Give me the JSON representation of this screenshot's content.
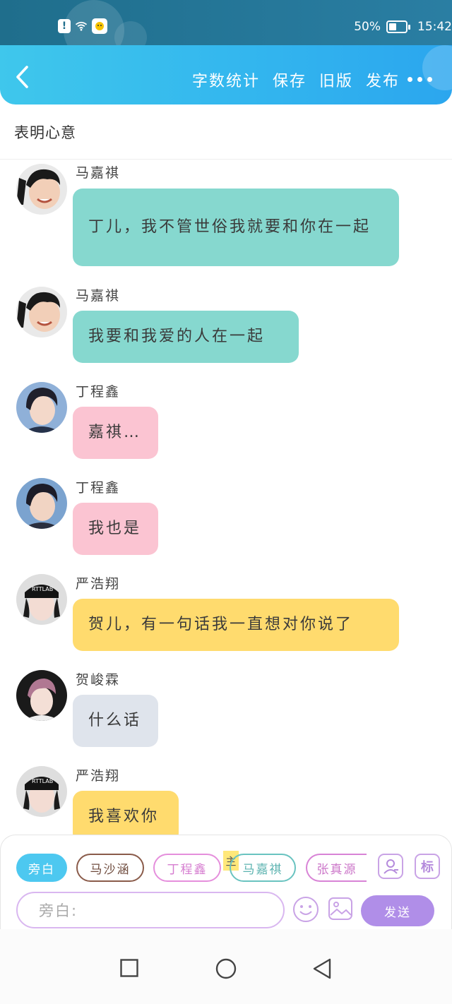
{
  "status_bar": {
    "battery_text": "50%",
    "time": "15:42",
    "battery_level": 0.5
  },
  "header": {
    "actions": [
      "字数统计",
      "保存",
      "旧版",
      "发布"
    ]
  },
  "title": "表明心意",
  "messages": [
    {
      "sender": "马嘉祺",
      "text": "丁儿，我不管世俗我就要和你在一起",
      "color": "#86d8cf"
    },
    {
      "sender": "马嘉祺",
      "text": "我要和我爱的人在一起",
      "color": "#86d8cf"
    },
    {
      "sender": "丁程鑫",
      "text": "嘉祺…",
      "color": "#fbc4d2"
    },
    {
      "sender": "丁程鑫",
      "text": "我也是",
      "color": "#fbc4d2"
    },
    {
      "sender": "严浩翔",
      "text": "贺儿，有一句话我一直想对你说了",
      "color": "#ffdb6e"
    },
    {
      "sender": "贺峻霖",
      "text": "什么话",
      "color": "#dfe4ec"
    },
    {
      "sender": "严浩翔",
      "text": "我喜欢你",
      "color": "#ffdb6e"
    }
  ],
  "composer": {
    "roles": [
      "旁白",
      "马沙涵",
      "丁程鑫",
      "马嘉祺",
      "张真源"
    ],
    "main_tag": "主",
    "mark_label": "标",
    "input_placeholder": "旁白:",
    "send_label": "发送"
  }
}
